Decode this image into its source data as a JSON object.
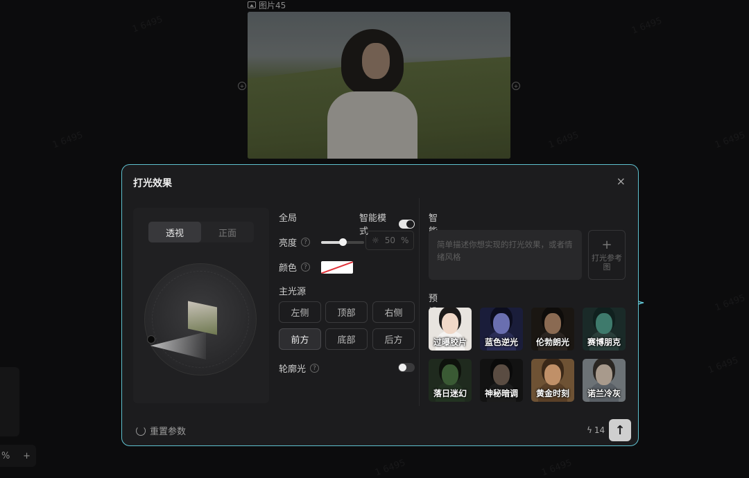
{
  "canvas": {
    "image_label": "图片45",
    "zoom_text": "%",
    "zoom_plus": "+"
  },
  "dialog": {
    "title": "打光效果",
    "close": "×",
    "view_tabs": [
      {
        "label": "透视",
        "active": true
      },
      {
        "label": "正面",
        "active": false
      }
    ],
    "global_label": "全局",
    "smart_mode_toggle_label": "智能模式",
    "smart_mode_on": true,
    "brightness": {
      "label": "亮度",
      "value": 50,
      "value_text": "50",
      "unit": "%"
    },
    "color_label": "颜色",
    "main_light_label": "主光源",
    "directions": [
      {
        "label": "左侧",
        "active": false
      },
      {
        "label": "顶部",
        "active": false
      },
      {
        "label": "右侧",
        "active": false
      },
      {
        "label": "前方",
        "active": true
      },
      {
        "label": "底部",
        "active": false
      },
      {
        "label": "后方",
        "active": false
      }
    ],
    "rim_light": {
      "label": "轮廓光",
      "on": false
    },
    "smart_mode_heading": "智能模式",
    "prompt_placeholder": "简单描述你想实现的打光效果，或者情绪风格",
    "reference_button": "打光参考图",
    "presets_heading": "预设",
    "presets": [
      {
        "label": "过曝胶片",
        "bg": "#e8e4df",
        "head": "#f0d8c8",
        "hair": "#1c1a1a",
        "body": "#f4f2f0"
      },
      {
        "label": "蓝色逆光",
        "bg": "#1a1d3a",
        "head": "#6a6fb0",
        "hair": "#0c0d1e",
        "body": "#2a2d55"
      },
      {
        "label": "伦勃朗光",
        "bg": "#1a1612",
        "head": "#8a6a52",
        "hair": "#0e0c0a",
        "body": "#2a2420"
      },
      {
        "label": "赛博朋克",
        "bg": "#1a2a28",
        "head": "#3e7a6c",
        "hair": "#10201e",
        "body": "#2a3e3a"
      },
      {
        "label": "落日迷幻",
        "bg": "#1f2a1e",
        "head": "#3a5a34",
        "hair": "#0e120c",
        "body": "#233322"
      },
      {
        "label": "神秘暗调",
        "bg": "#121212",
        "head": "#5a4c42",
        "hair": "#0a0a0a",
        "body": "#1c1c1c"
      },
      {
        "label": "黄金时刻",
        "bg": "#6e5234",
        "head": "#c09068",
        "hair": "#3a2818",
        "body": "#5a4028"
      },
      {
        "label": "诺兰冷灰",
        "bg": "#6c7276",
        "head": "#a89a8c",
        "hair": "#2a2622",
        "body": "#5a6066"
      }
    ],
    "reset_label": "重置参数",
    "credits": "14",
    "send_icon": "↑"
  }
}
